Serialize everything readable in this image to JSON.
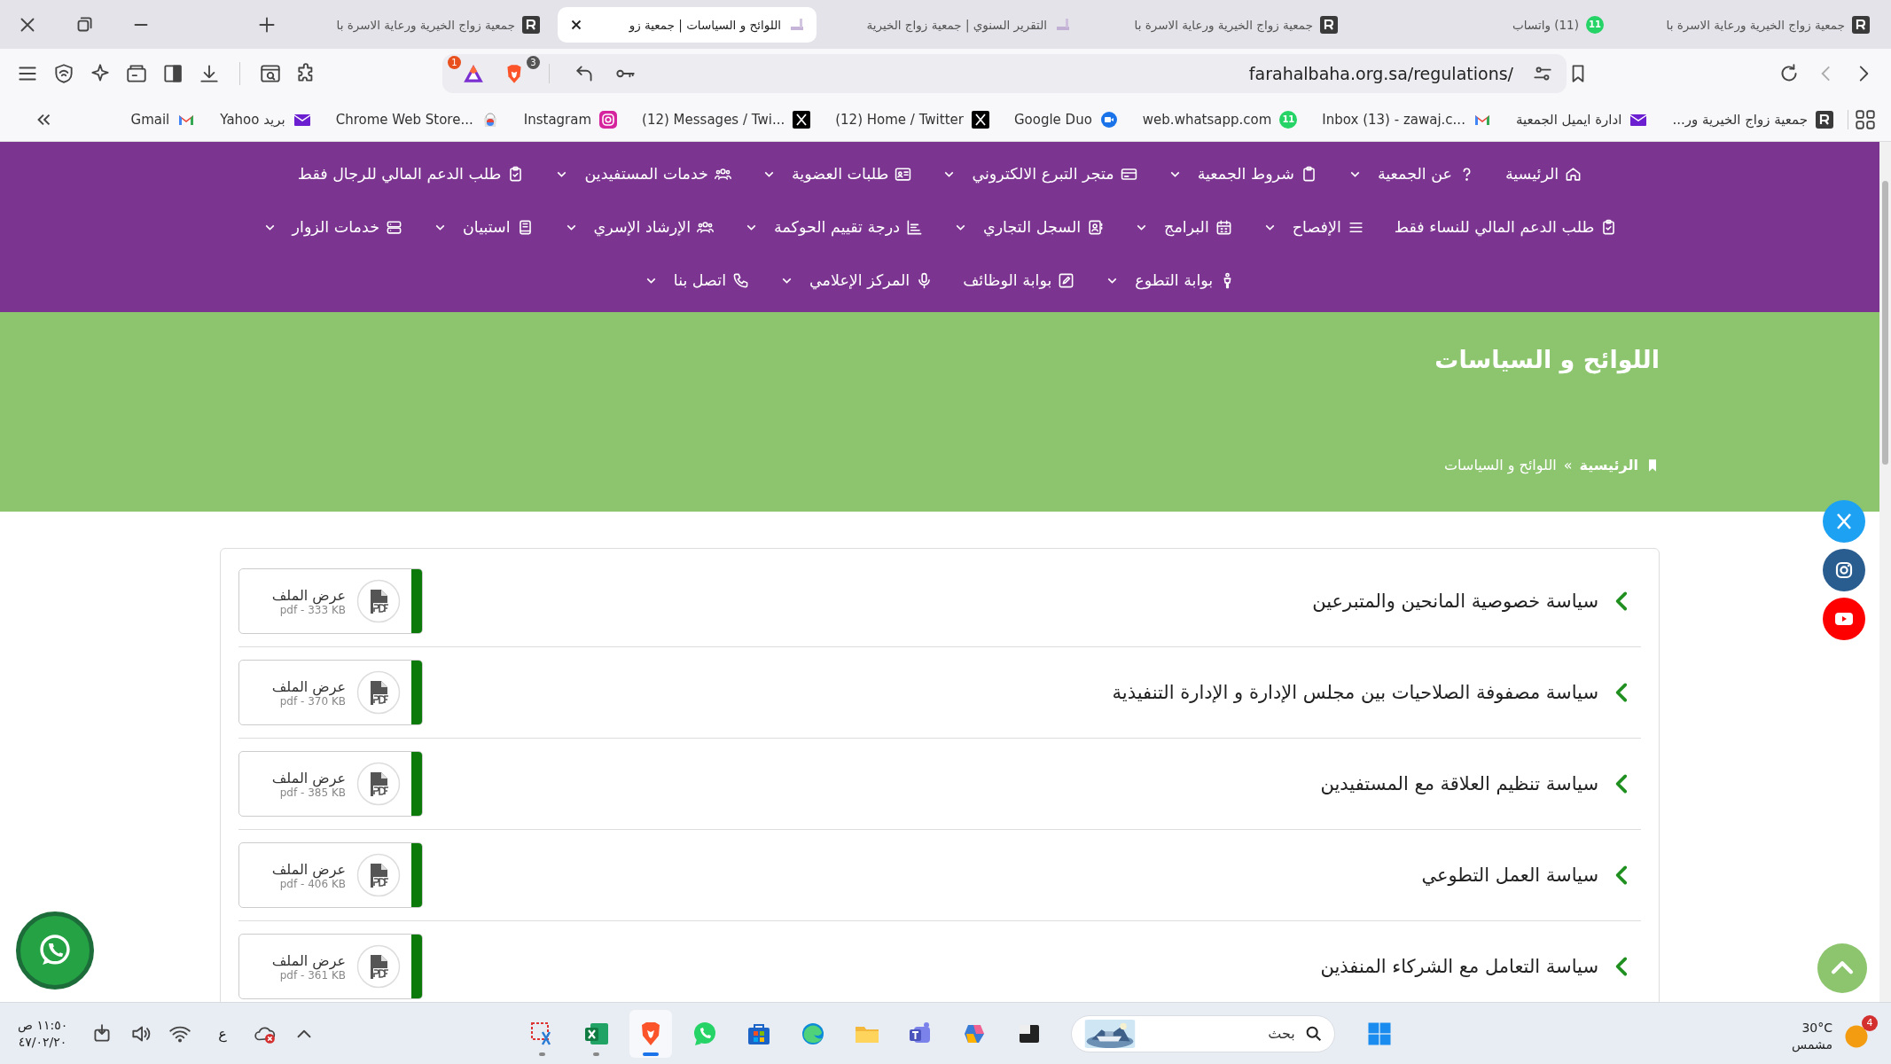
{
  "browser": {
    "tabs": [
      {
        "title": "جمعية زواج الخيرية ورعاية الاسرة با",
        "kind": "site",
        "selected": false
      },
      {
        "title": "(11) واتساب",
        "kind": "whatsapp",
        "badge": "11",
        "selected": false
      },
      {
        "title": "جمعية زواج الخيرية ورعاية الاسرة با",
        "kind": "site",
        "selected": false
      },
      {
        "title": "التقرير السنوي | جمعية زواج الخيرية",
        "kind": "page",
        "selected": false
      },
      {
        "title": "اللوائح و السياسات | جمعية زو",
        "kind": "page",
        "selected": true
      },
      {
        "title": "جمعية زواج الخيرية ورعاية الاسرة با",
        "kind": "site",
        "selected": false
      }
    ],
    "toolbar": {
      "rewards_badge": "1",
      "shields_badge": "3",
      "url": "farahalbaha.org.sa/regulations/"
    },
    "bookmarks": [
      {
        "label": "جمعية زواج الخيرية ور...",
        "kind": "site"
      },
      {
        "label": "ادارة ايميل الجمعية",
        "kind": "envelope"
      },
      {
        "label": "Inbox (13) - zawaj.c...",
        "kind": "gmail"
      },
      {
        "label": "web.whatsapp.com",
        "kind": "whatsapp",
        "badge": "11"
      },
      {
        "label": "Google Duo",
        "kind": "duo"
      },
      {
        "label": "(12) Home / Twitter",
        "kind": "x"
      },
      {
        "label": "(12) Messages / Twi...",
        "kind": "x"
      },
      {
        "label": "Instagram",
        "kind": "instagram"
      },
      {
        "label": "Chrome Web Store...",
        "kind": "store"
      },
      {
        "label": "بريد Yahoo",
        "kind": "envelope"
      },
      {
        "label": "Gmail",
        "kind": "gmail"
      }
    ]
  },
  "nav": {
    "rows": [
      {
        "links": [
          {
            "label": "الرئيسية",
            "dropdown": false
          },
          {
            "label": "عن الجمعية",
            "dropdown": true
          },
          {
            "label": "شروط الجمعية",
            "dropdown": true
          },
          {
            "label": "متجر التبرع الالكتروني",
            "dropdown": true
          },
          {
            "label": "طلبات العضوية",
            "dropdown": true
          },
          {
            "label": "خدمات المستفيدين",
            "dropdown": true
          },
          {
            "label": "طلب الدعم المالي للرجال فقط",
            "dropdown": false
          }
        ]
      },
      {
        "links": [
          {
            "label": "طلب الدعم المالي للنساء فقط",
            "dropdown": false
          },
          {
            "label": "الإفصاح",
            "dropdown": true
          },
          {
            "label": "البرامج",
            "dropdown": true
          },
          {
            "label": "السجل التجاري",
            "dropdown": true
          },
          {
            "label": "درجة تقييم الحوكمة",
            "dropdown": true
          },
          {
            "label": "الإرشاد الإسري",
            "dropdown": true
          },
          {
            "label": "استبيان",
            "dropdown": true
          },
          {
            "label": "خدمات الزوار",
            "dropdown": true
          }
        ]
      },
      {
        "links": [
          {
            "label": "بوابة التطوع",
            "dropdown": true
          },
          {
            "label": "بوابة الوظائف",
            "dropdown": false
          },
          {
            "label": "المركز الإعلامي",
            "dropdown": true
          },
          {
            "label": "اتصل بنا",
            "dropdown": true
          }
        ]
      }
    ]
  },
  "hero": {
    "title": "اللوائح و السياسات",
    "separator": "»",
    "breadcrumb": [
      {
        "label": "الرئيسية",
        "current": false
      },
      {
        "label": "اللوائح و السياسات",
        "current": true
      }
    ]
  },
  "documents": [
    {
      "title": "سياسة خصوصية المانحين والمتبرعين",
      "action": "عرض الملف",
      "meta": "pdf - 333 KB"
    },
    {
      "title": "سياسة مصفوفة الصلاحيات بين مجلس الإدارة و الإدارة التنفيذية",
      "action": "عرض الملف",
      "meta": "pdf - 370 KB"
    },
    {
      "title": "سياسة تنظيم العلاقة مع المستفيدين",
      "action": "عرض الملف",
      "meta": "pdf - 385 KB"
    },
    {
      "title": "سياسة العمل التطوعي",
      "action": "عرض الملف",
      "meta": "pdf - 406 KB"
    },
    {
      "title": "سياسة التعامل مع الشركاء المنفذين",
      "action": "عرض الملف",
      "meta": "pdf - 361 KB"
    }
  ],
  "social": [
    {
      "kind": "x",
      "color": "#1da1f2"
    },
    {
      "kind": "instagram",
      "color": "#2a5d8f"
    },
    {
      "kind": "youtube",
      "color": "#ff0000"
    }
  ],
  "taskbar": {
    "time": "١١:٥٠ ص",
    "date": "٤٧/٠٢/٢٠",
    "input_language": "ع",
    "search": {
      "placeholder": "بحث"
    },
    "apps": [
      {
        "kind": "snip",
        "running": true,
        "selected": false
      },
      {
        "kind": "excel",
        "running": true,
        "selected": false
      },
      {
        "kind": "brave",
        "running": true,
        "selected": true
      },
      {
        "kind": "whatsapp",
        "running": false,
        "selected": false
      },
      {
        "kind": "store",
        "running": false,
        "selected": false
      },
      {
        "kind": "edge",
        "running": false,
        "selected": false
      },
      {
        "kind": "explorer",
        "running": false,
        "selected": false
      },
      {
        "kind": "teams",
        "running": false,
        "selected": false
      },
      {
        "kind": "copilot",
        "running": false,
        "selected": false
      },
      {
        "kind": "terminal",
        "running": false,
        "selected": false
      }
    ],
    "weather": {
      "temperature": "30°C",
      "condition": "مشمس",
      "badge": "4"
    }
  }
}
